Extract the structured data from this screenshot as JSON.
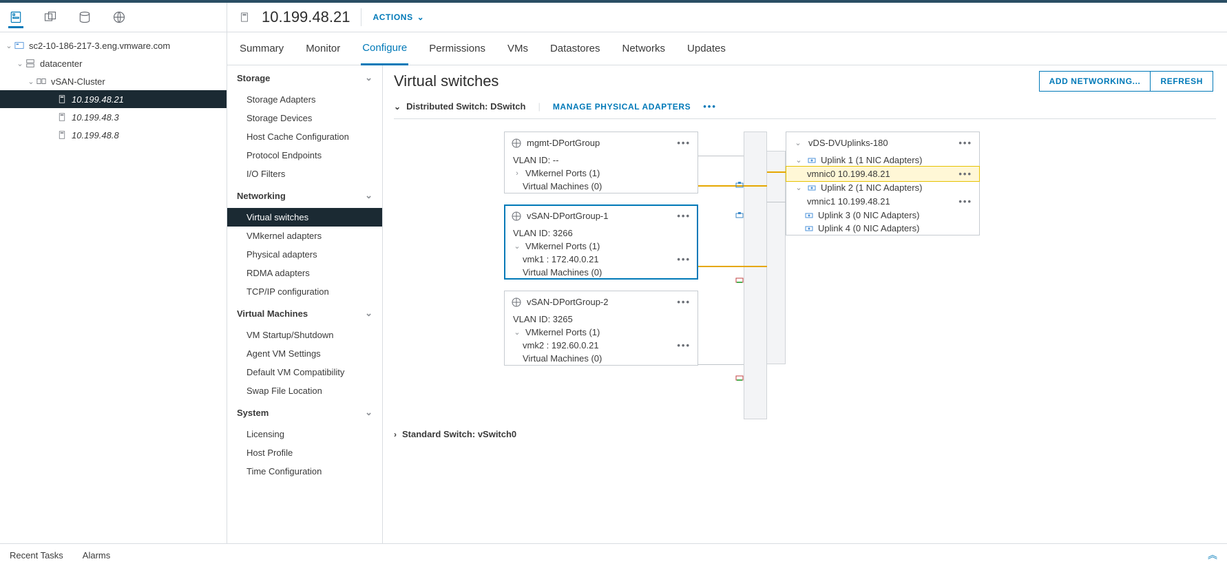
{
  "header": {
    "host_ip": "10.199.48.21",
    "actions_label": "ACTIONS"
  },
  "tabs": [
    {
      "label": "Summary"
    },
    {
      "label": "Monitor"
    },
    {
      "label": "Configure",
      "active": true
    },
    {
      "label": "Permissions"
    },
    {
      "label": "VMs"
    },
    {
      "label": "Datastores"
    },
    {
      "label": "Networks"
    },
    {
      "label": "Updates"
    }
  ],
  "nav_tree": {
    "vcenter": "sc2-10-186-217-3.eng.vmware.com",
    "datacenter": "datacenter",
    "cluster": "vSAN-Cluster",
    "hosts": [
      {
        "name": "10.199.48.21",
        "selected": true,
        "italic": true
      },
      {
        "name": "10.199.48.3",
        "selected": false,
        "italic": true
      },
      {
        "name": "10.199.48.8",
        "selected": false,
        "italic": true
      }
    ]
  },
  "config_nav": {
    "sections": [
      {
        "title": "Storage",
        "open": true,
        "items": [
          "Storage Adapters",
          "Storage Devices",
          "Host Cache Configuration",
          "Protocol Endpoints",
          "I/O Filters"
        ]
      },
      {
        "title": "Networking",
        "open": true,
        "items": [
          "Virtual switches",
          "VMkernel adapters",
          "Physical adapters",
          "RDMA adapters",
          "TCP/IP configuration"
        ],
        "selected": "Virtual switches"
      },
      {
        "title": "Virtual Machines",
        "open": true,
        "items": [
          "VM Startup/Shutdown",
          "Agent VM Settings",
          "Default VM Compatibility",
          "Swap File Location"
        ]
      },
      {
        "title": "System",
        "open": true,
        "items": [
          "Licensing",
          "Host Profile",
          "Time Configuration"
        ]
      }
    ]
  },
  "detail": {
    "title": "Virtual switches",
    "buttons": {
      "add": "ADD NETWORKING...",
      "refresh": "REFRESH"
    },
    "dswitch": {
      "label_prefix": "Distributed Switch:",
      "name": "DSwitch",
      "manage_link": "MANAGE PHYSICAL ADAPTERS",
      "portgroups": [
        {
          "name": "mgmt-DPortGroup",
          "vlan": "VLAN ID: --",
          "vkp": "VMkernel Ports (1)",
          "vms": "Virtual Machines (0)",
          "vkp_open": false,
          "selected": false
        },
        {
          "name": "vSAN-DPortGroup-1",
          "vlan": "VLAN ID: 3266",
          "vkp": "VMkernel Ports (1)",
          "vmk": "vmk1 : 172.40.0.21",
          "vms": "Virtual Machines (0)",
          "vkp_open": true,
          "selected": true
        },
        {
          "name": "vSAN-DPortGroup-2",
          "vlan": "VLAN ID: 3265",
          "vkp": "VMkernel Ports (1)",
          "vmk": "vmk2 : 192.60.0.21",
          "vms": "Virtual Machines (0)",
          "vkp_open": true,
          "selected": false
        }
      ],
      "uplinks_card": {
        "name": "vDS-DVUplinks-180",
        "uplinks": [
          {
            "name": "Uplink 1 (1 NIC Adapters)",
            "open": true,
            "nic": "vmnic0 10.199.48.21",
            "highlight": true
          },
          {
            "name": "Uplink 2 (1 NIC Adapters)",
            "open": true,
            "nic": "vmnic1 10.199.48.21",
            "highlight": false
          },
          {
            "name": "Uplink 3 (0 NIC Adapters)",
            "open": false
          },
          {
            "name": "Uplink 4 (0 NIC Adapters)",
            "open": false
          }
        ]
      }
    },
    "stdswitch": {
      "label_prefix": "Standard Switch:",
      "name": "vSwitch0"
    }
  },
  "bottom": {
    "recent": "Recent Tasks",
    "alarms": "Alarms"
  }
}
